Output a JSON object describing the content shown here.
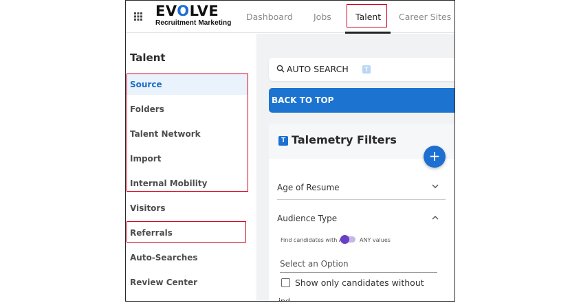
{
  "brand": {
    "name_prefix": "EV",
    "name_o": "O",
    "name_suffix": "LVE",
    "subtitle": "Recruitment Marketing"
  },
  "nav": {
    "items": [
      {
        "label": "Dashboard"
      },
      {
        "label": "Jobs"
      },
      {
        "label": "Talent",
        "active": true
      },
      {
        "label": "Career Sites"
      }
    ]
  },
  "sidebar": {
    "title": "Talent",
    "items": [
      {
        "label": "Source",
        "active": true
      },
      {
        "label": "Folders"
      },
      {
        "label": "Talent Network"
      },
      {
        "label": "Import"
      },
      {
        "label": "Internal Mobility"
      },
      {
        "label": "Visitors"
      },
      {
        "label": "Referrals"
      },
      {
        "label": "Auto-Searches"
      },
      {
        "label": "Review Center"
      }
    ]
  },
  "main": {
    "auto_search_label": "AUTO SEARCH",
    "auto_search_badge": "T",
    "back_to_top_label": "BACK TO TOP",
    "filters": {
      "badge": "T",
      "title": "Talemetry Filters",
      "add_label": "+",
      "age_of_resume": "Age of Resume",
      "audience_type": "Audience Type",
      "find_prefix": "Find candidates with ALL",
      "find_suffix": "ANY values",
      "select_placeholder": "Select an Option",
      "checkbox_label": "Show only candidates without",
      "cut_text": "ind"
    }
  },
  "colors": {
    "accent": "#1d6fd1",
    "back_to_top_bg": "#1d74d0",
    "toggle_knob": "#6a3fc5",
    "annotation": "#d0021b"
  }
}
